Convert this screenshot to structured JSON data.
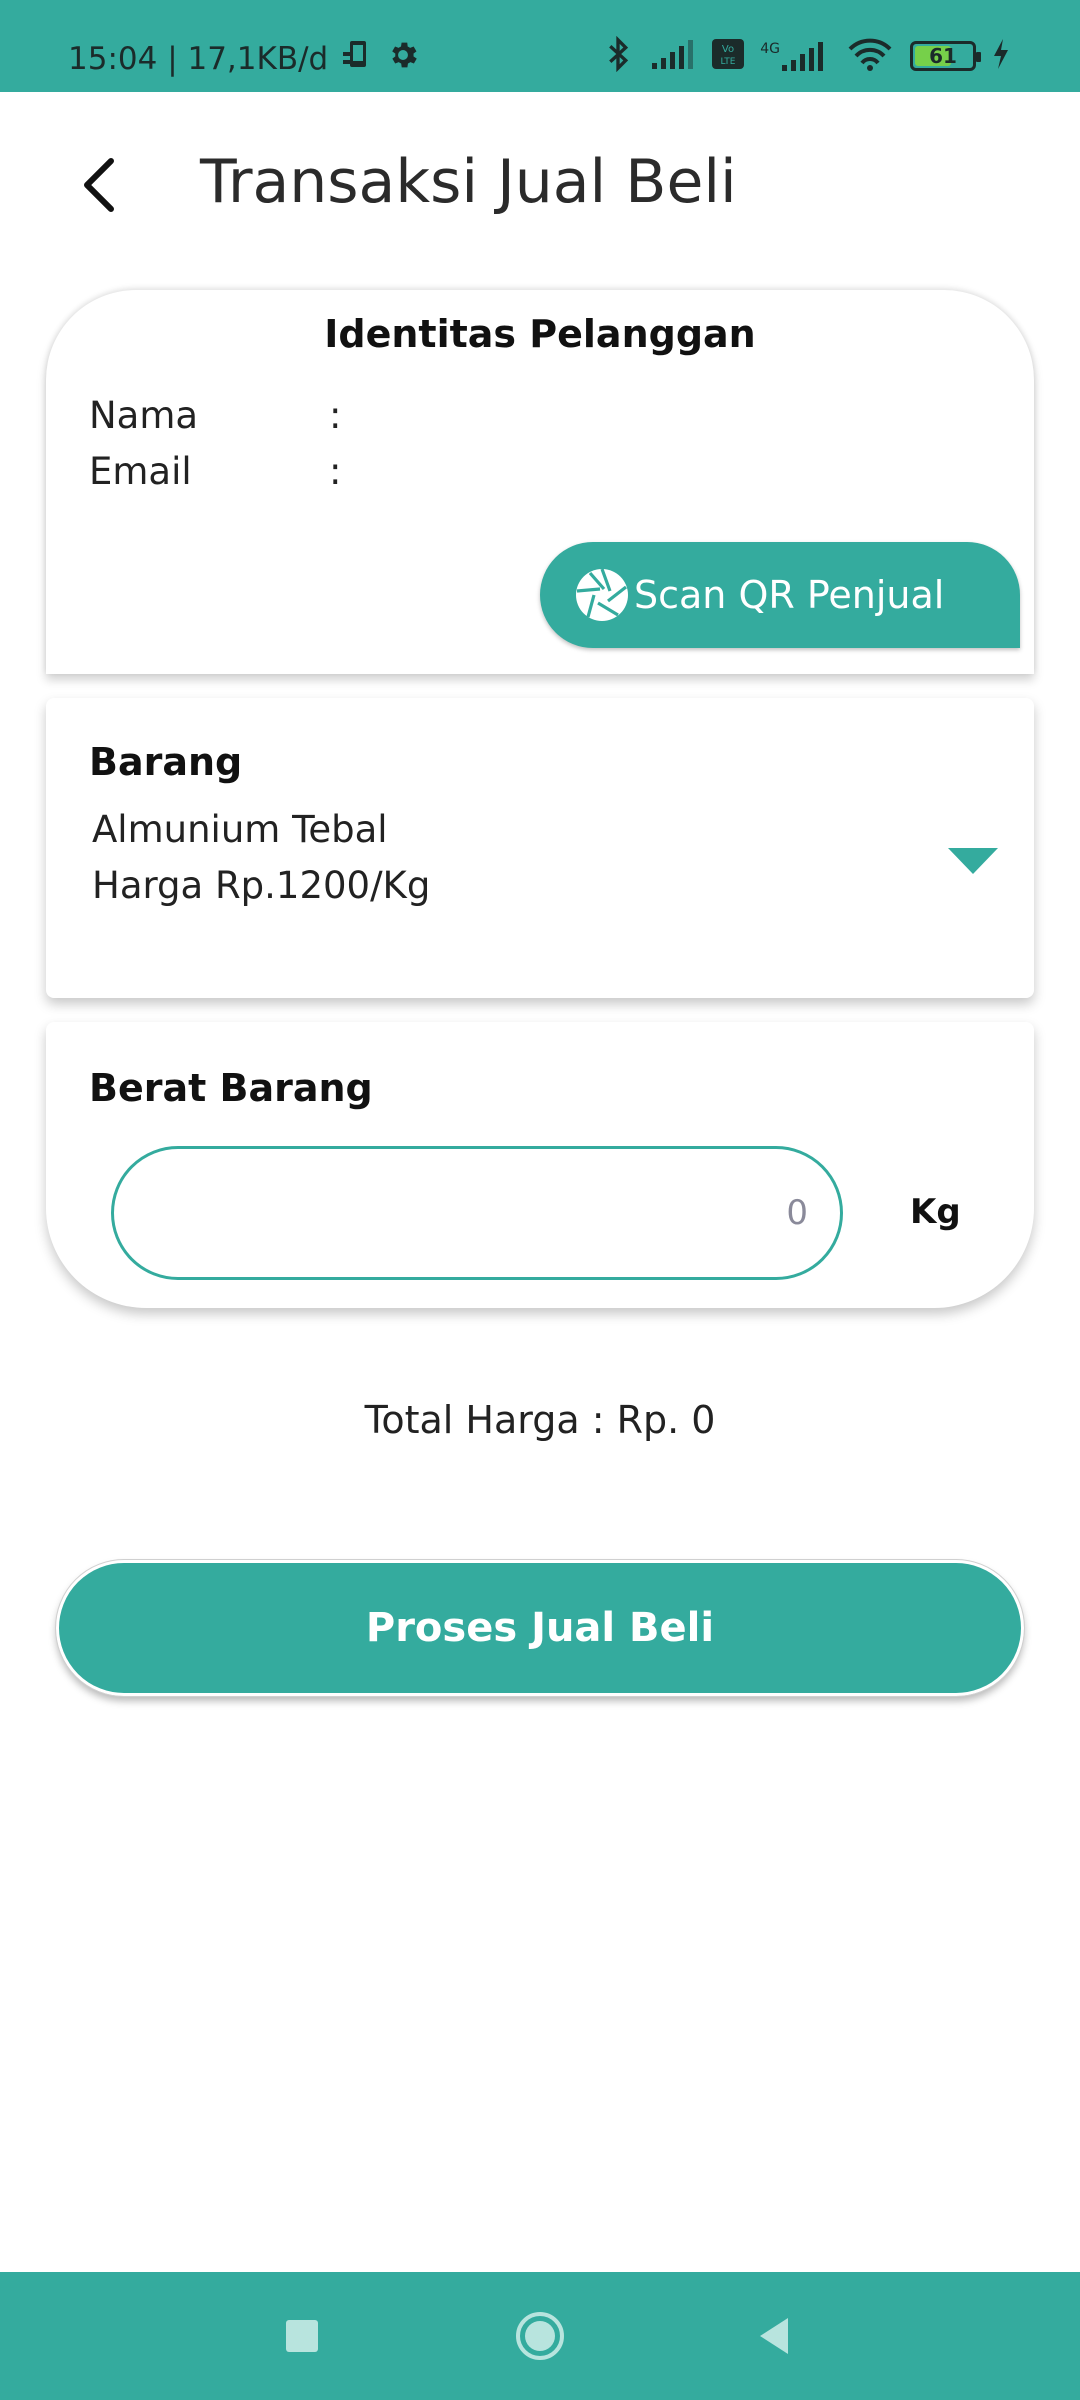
{
  "status_bar": {
    "time_speed": "15:04 | 17,1KB/d",
    "network_label": "4G",
    "battery_level": "61",
    "icons": [
      "phone-sync-icon",
      "gear-icon",
      "bluetooth-icon",
      "signal-icon",
      "volte-icon",
      "signal-4g-icon",
      "wifi-icon",
      "battery-icon",
      "charging-icon"
    ]
  },
  "header": {
    "title": "Transaksi Jual Beli",
    "back_icon": "chevron-left-icon"
  },
  "identity": {
    "title": "Identitas Pelanggan",
    "name_label": "Nama",
    "name_sep": ":",
    "name_value": "",
    "email_label": "Email",
    "email_sep": ":",
    "email_value": "",
    "scan_button_label": "Scan QR Penjual",
    "scan_icon": "camera-aperture-icon"
  },
  "item": {
    "heading": "Barang",
    "name": "Almunium Tebal",
    "price": "Harga Rp.1200/Kg",
    "dropdown_icon": "triangle-down-icon"
  },
  "weight": {
    "heading": "Berat Barang",
    "value": "",
    "placeholder": "0",
    "unit": "Kg"
  },
  "total": {
    "text": "Total Harga : Rp. 0"
  },
  "process_button_label": "Proses Jual Beli",
  "nav": {
    "icons": [
      "recents-square-icon",
      "home-circle-icon",
      "back-triangle-icon"
    ]
  },
  "colors": {
    "accent": "#34ab9e",
    "nav_icon": "#b8e4de",
    "text": "#222222"
  }
}
